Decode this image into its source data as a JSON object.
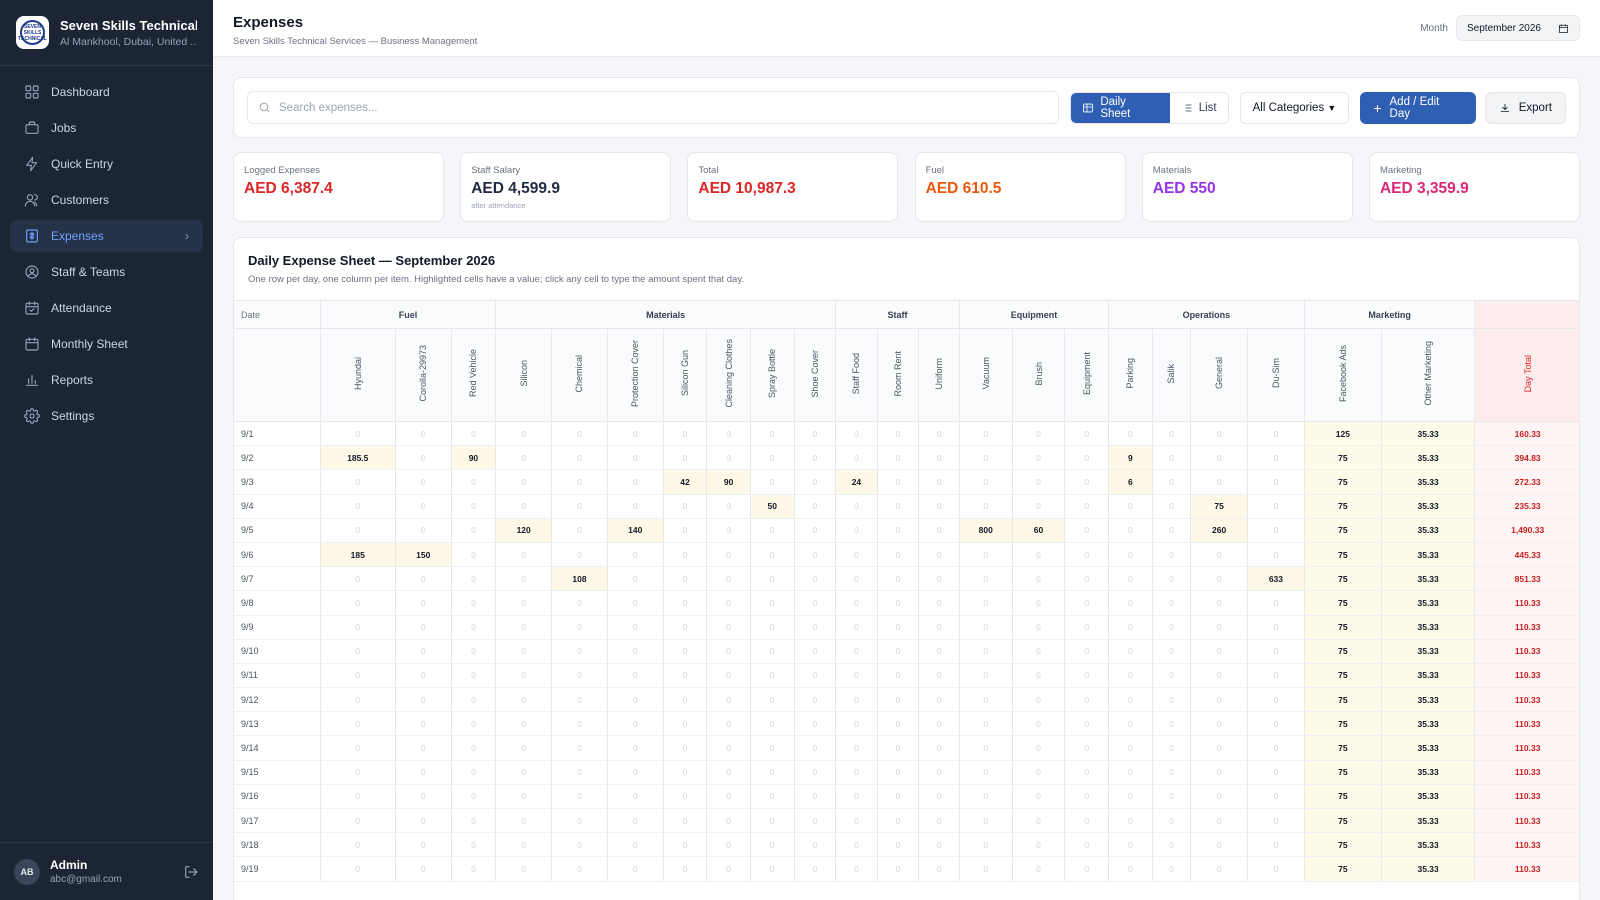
{
  "sidebar": {
    "company_name": "Seven Skills Technical ...",
    "company_location": "Al Mankhool, Dubai, United ...",
    "logo_text": "SEVEN SKILLS TECHNICAL",
    "items": [
      {
        "label": "Dashboard",
        "icon": "dashboard-icon"
      },
      {
        "label": "Jobs",
        "icon": "briefcase-icon"
      },
      {
        "label": "Quick Entry",
        "icon": "bolt-icon"
      },
      {
        "label": "Customers",
        "icon": "users-icon"
      },
      {
        "label": "Expenses",
        "icon": "receipt-icon",
        "active": true
      },
      {
        "label": "Staff & Teams",
        "icon": "user-circle-icon"
      },
      {
        "label": "Attendance",
        "icon": "calendar-check-icon"
      },
      {
        "label": "Monthly Sheet",
        "icon": "calendar-icon"
      },
      {
        "label": "Reports",
        "icon": "bar-chart-icon"
      },
      {
        "label": "Settings",
        "icon": "gear-icon"
      }
    ],
    "user": {
      "initials": "AB",
      "name": "Admin",
      "email": "abc@gmail.com"
    }
  },
  "header": {
    "title": "Expenses",
    "subtitle": "Seven Skills Technical Services — Business Management",
    "month_label": "Month",
    "month_value": "September 2026"
  },
  "toolbar": {
    "search_placeholder": "Search expenses...",
    "daily_sheet_label": "Daily Sheet",
    "list_label": "List",
    "category_value": "All Categories",
    "add_label": "Add / Edit Day",
    "export_label": "Export"
  },
  "cards": [
    {
      "label": "Logged Expenses",
      "value": "AED 6,387.4",
      "color": "#dc2626",
      "note": ""
    },
    {
      "label": "Staff Salary",
      "value": "AED 4,599.9",
      "color": "#1f2a44",
      "note": "after attendance"
    },
    {
      "label": "Total",
      "value": "AED 10,987.3",
      "color": "#dc2626",
      "note": ""
    },
    {
      "label": "Fuel",
      "value": "AED 610.5",
      "color": "#ea580c",
      "note": ""
    },
    {
      "label": "Materials",
      "value": "AED 550",
      "color": "#9333ea",
      "note": ""
    },
    {
      "label": "Marketing",
      "value": "AED 3,359.9",
      "color": "#db2777",
      "note": ""
    }
  ],
  "sheet": {
    "title": "Daily Expense Sheet — September 2026",
    "subtitle": "One row per day, one column per item. Highlighted cells have a value; click any cell to type the amount spent that day.",
    "date_header": "Date",
    "day_total_header": "Day Total",
    "groups": [
      {
        "name": "Fuel",
        "items": [
          "Hyundai",
          "Corolla-29973",
          "Red Vehicle"
        ]
      },
      {
        "name": "Materials",
        "items": [
          "Silicon",
          "Chemical",
          "Protection Cover",
          "Silicon Gun",
          "Cleaning Clothes",
          "Spray Bottle",
          "Shoe Cover"
        ]
      },
      {
        "name": "Staff",
        "items": [
          "Staff Food",
          "Room Rent",
          "Uniform"
        ]
      },
      {
        "name": "Equipment",
        "items": [
          "Vacuum",
          "Brush",
          "Equipment"
        ]
      },
      {
        "name": "Operations",
        "items": [
          "Parking",
          "Salik",
          "General",
          "Du-Sim"
        ]
      },
      {
        "name": "Marketing",
        "items": [
          "Facebook Ads",
          "Other Marketing"
        ]
      }
    ],
    "rows": [
      {
        "date": "9/1",
        "values": [
          "0",
          "0",
          "0",
          "0",
          "0",
          "0",
          "0",
          "0",
          "0",
          "0",
          "0",
          "0",
          "0",
          "0",
          "0",
          "0",
          "0",
          "0",
          "0",
          "0",
          "125",
          "35.33"
        ],
        "total": "160.33"
      },
      {
        "date": "9/2",
        "values": [
          "185.5",
          "0",
          "90",
          "0",
          "0",
          "0",
          "0",
          "0",
          "0",
          "0",
          "0",
          "0",
          "0",
          "0",
          "0",
          "0",
          "9",
          "0",
          "0",
          "0",
          "75",
          "35.33"
        ],
        "total": "394.83"
      },
      {
        "date": "9/3",
        "values": [
          "0",
          "0",
          "0",
          "0",
          "0",
          "0",
          "42",
          "90",
          "0",
          "0",
          "24",
          "0",
          "0",
          "0",
          "0",
          "0",
          "6",
          "0",
          "0",
          "0",
          "75",
          "35.33"
        ],
        "total": "272.33"
      },
      {
        "date": "9/4",
        "values": [
          "0",
          "0",
          "0",
          "0",
          "0",
          "0",
          "0",
          "0",
          "50",
          "0",
          "0",
          "0",
          "0",
          "0",
          "0",
          "0",
          "0",
          "0",
          "75",
          "0",
          "75",
          "35.33"
        ],
        "total": "235.33"
      },
      {
        "date": "9/5",
        "values": [
          "0",
          "0",
          "0",
          "120",
          "0",
          "140",
          "0",
          "0",
          "0",
          "0",
          "0",
          "0",
          "0",
          "800",
          "60",
          "0",
          "0",
          "0",
          "260",
          "0",
          "75",
          "35.33"
        ],
        "total": "1,490.33"
      },
      {
        "date": "9/6",
        "values": [
          "185",
          "150",
          "0",
          "0",
          "0",
          "0",
          "0",
          "0",
          "0",
          "0",
          "0",
          "0",
          "0",
          "0",
          "0",
          "0",
          "0",
          "0",
          "0",
          "0",
          "75",
          "35.33"
        ],
        "total": "445.33"
      },
      {
        "date": "9/7",
        "values": [
          "0",
          "0",
          "0",
          "0",
          "108",
          "0",
          "0",
          "0",
          "0",
          "0",
          "0",
          "0",
          "0",
          "0",
          "0",
          "0",
          "0",
          "0",
          "0",
          "633",
          "75",
          "35.33"
        ],
        "total": "851.33"
      },
      {
        "date": "9/8",
        "values": [
          "0",
          "0",
          "0",
          "0",
          "0",
          "0",
          "0",
          "0",
          "0",
          "0",
          "0",
          "0",
          "0",
          "0",
          "0",
          "0",
          "0",
          "0",
          "0",
          "0",
          "75",
          "35.33"
        ],
        "total": "110.33"
      },
      {
        "date": "9/9",
        "values": [
          "0",
          "0",
          "0",
          "0",
          "0",
          "0",
          "0",
          "0",
          "0",
          "0",
          "0",
          "0",
          "0",
          "0",
          "0",
          "0",
          "0",
          "0",
          "0",
          "0",
          "75",
          "35.33"
        ],
        "total": "110.33"
      },
      {
        "date": "9/10",
        "values": [
          "0",
          "0",
          "0",
          "0",
          "0",
          "0",
          "0",
          "0",
          "0",
          "0",
          "0",
          "0",
          "0",
          "0",
          "0",
          "0",
          "0",
          "0",
          "0",
          "0",
          "75",
          "35.33"
        ],
        "total": "110.33"
      },
      {
        "date": "9/11",
        "values": [
          "0",
          "0",
          "0",
          "0",
          "0",
          "0",
          "0",
          "0",
          "0",
          "0",
          "0",
          "0",
          "0",
          "0",
          "0",
          "0",
          "0",
          "0",
          "0",
          "0",
          "75",
          "35.33"
        ],
        "total": "110.33"
      },
      {
        "date": "9/12",
        "values": [
          "0",
          "0",
          "0",
          "0",
          "0",
          "0",
          "0",
          "0",
          "0",
          "0",
          "0",
          "0",
          "0",
          "0",
          "0",
          "0",
          "0",
          "0",
          "0",
          "0",
          "75",
          "35.33"
        ],
        "total": "110.33"
      },
      {
        "date": "9/13",
        "values": [
          "0",
          "0",
          "0",
          "0",
          "0",
          "0",
          "0",
          "0",
          "0",
          "0",
          "0",
          "0",
          "0",
          "0",
          "0",
          "0",
          "0",
          "0",
          "0",
          "0",
          "75",
          "35.33"
        ],
        "total": "110.33"
      },
      {
        "date": "9/14",
        "values": [
          "0",
          "0",
          "0",
          "0",
          "0",
          "0",
          "0",
          "0",
          "0",
          "0",
          "0",
          "0",
          "0",
          "0",
          "0",
          "0",
          "0",
          "0",
          "0",
          "0",
          "75",
          "35.33"
        ],
        "total": "110.33"
      },
      {
        "date": "9/15",
        "values": [
          "0",
          "0",
          "0",
          "0",
          "0",
          "0",
          "0",
          "0",
          "0",
          "0",
          "0",
          "0",
          "0",
          "0",
          "0",
          "0",
          "0",
          "0",
          "0",
          "0",
          "75",
          "35.33"
        ],
        "total": "110.33"
      },
      {
        "date": "9/16",
        "values": [
          "0",
          "0",
          "0",
          "0",
          "0",
          "0",
          "0",
          "0",
          "0",
          "0",
          "0",
          "0",
          "0",
          "0",
          "0",
          "0",
          "0",
          "0",
          "0",
          "0",
          "75",
          "35.33"
        ],
        "total": "110.33"
      },
      {
        "date": "9/17",
        "values": [
          "0",
          "0",
          "0",
          "0",
          "0",
          "0",
          "0",
          "0",
          "0",
          "0",
          "0",
          "0",
          "0",
          "0",
          "0",
          "0",
          "0",
          "0",
          "0",
          "0",
          "75",
          "35.33"
        ],
        "total": "110.33"
      },
      {
        "date": "9/18",
        "values": [
          "0",
          "0",
          "0",
          "0",
          "0",
          "0",
          "0",
          "0",
          "0",
          "0",
          "0",
          "0",
          "0",
          "0",
          "0",
          "0",
          "0",
          "0",
          "0",
          "0",
          "75",
          "35.33"
        ],
        "total": "110.33"
      },
      {
        "date": "9/19",
        "values": [
          "0",
          "0",
          "0",
          "0",
          "0",
          "0",
          "0",
          "0",
          "0",
          "0",
          "0",
          "0",
          "0",
          "0",
          "0",
          "0",
          "0",
          "0",
          "0",
          "0",
          "75",
          "35.33"
        ],
        "total": "110.33"
      }
    ]
  }
}
